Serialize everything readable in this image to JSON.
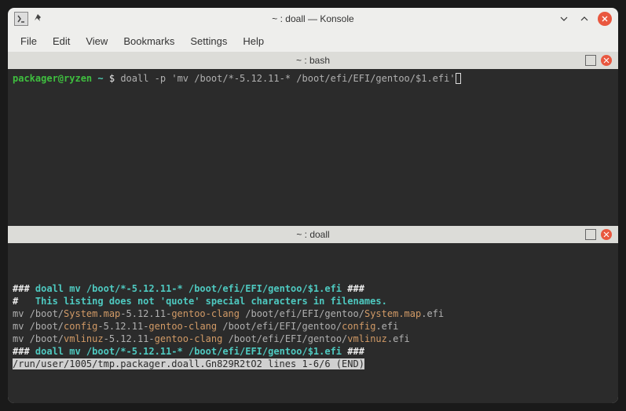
{
  "window": {
    "title": "~ : doall — Konsole"
  },
  "menu": {
    "file": "File",
    "edit": "Edit",
    "view": "View",
    "bookmarks": "Bookmarks",
    "settings": "Settings",
    "help": "Help"
  },
  "pane_top": {
    "title": "~ : bash",
    "prompt_user": "packager@ryzen",
    "prompt_path": "~",
    "prompt_symbol": "$",
    "command": "doall -p 'mv /boot/*-5.12.11-* /boot/efi/EFI/gentoo/$1.efi'"
  },
  "pane_bottom": {
    "title": "~ : doall",
    "header_prefix": "### ",
    "header_cmd": "doall mv /boot/*-5.12.11-* /boot/efi/EFI/gentoo/$1.efi",
    "header_suffix": " ###",
    "note_prefix": "#   ",
    "note": "This listing does not 'quote' special characters in filenames.",
    "lines": [
      {
        "pre": "mv /boot/",
        "a": "System.map",
        "mid": "-5.12.11-",
        "b": "gentoo-clang",
        "post1": " /boot/efi/EFI/gentoo/",
        "c": "System.map",
        "post2": ".efi"
      },
      {
        "pre": "mv /boot/",
        "a": "config",
        "mid": "-5.12.11-",
        "b": "gentoo-clang",
        "post1": " /boot/efi/EFI/gentoo/",
        "c": "config",
        "post2": ".efi"
      },
      {
        "pre": "mv /boot/",
        "a": "vmlinuz",
        "mid": "-5.12.11-",
        "b": "gentoo-clang",
        "post1": " /boot/efi/EFI/gentoo/",
        "c": "vmlinuz",
        "post2": ".efi"
      }
    ],
    "footer_prefix": "### ",
    "footer_cmd": "doall mv /boot/*-5.12.11-* /boot/efi/EFI/gentoo/$1.efi",
    "footer_suffix": " ###",
    "pager_status": "/run/user/1005/tmp.packager.doall.Gn829R2tO2 lines 1-6/6 (END)"
  }
}
